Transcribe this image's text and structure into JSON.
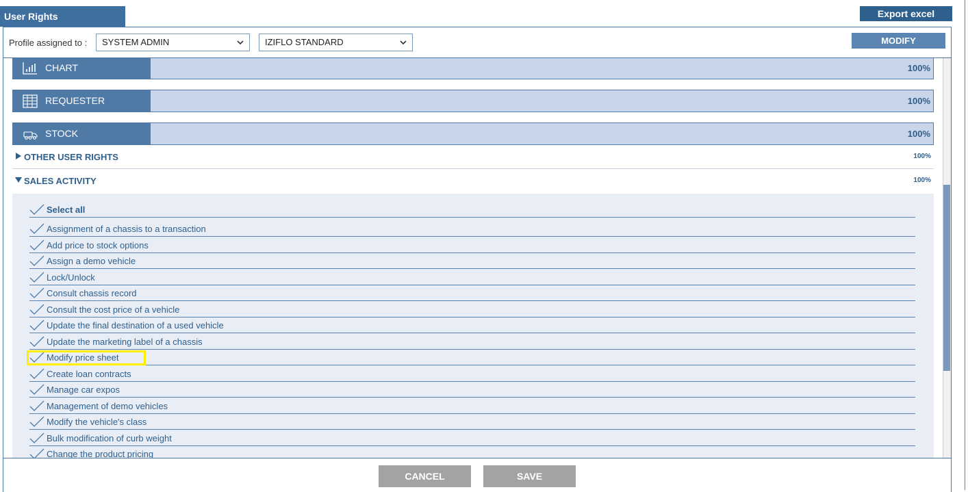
{
  "header": {
    "title": "User Rights",
    "export_label": "Export excel"
  },
  "profile": {
    "label": "Profile assigned to :",
    "select1_value": "SYSTEM ADMIN",
    "select2_value": "IZIFLO STANDARD",
    "modify_label": "MODIFY"
  },
  "sections": [
    {
      "label": "CHART",
      "icon": "bar-chart-icon",
      "percent": "100%"
    },
    {
      "label": "REQUESTER",
      "icon": "table-icon",
      "percent": "100%"
    },
    {
      "label": "STOCK",
      "icon": "truck-icon",
      "percent": "100%"
    }
  ],
  "subsections": [
    {
      "label": "OTHER USER RIGHTS",
      "state": "collapsed",
      "percent": "100%"
    },
    {
      "label": "SALES ACTIVITY",
      "state": "expanded",
      "percent": "100%"
    }
  ],
  "rights": {
    "select_all": "Select all",
    "items": [
      "Assignment of a chassis to a transaction",
      "Add price to stock options",
      "Assign a demo vehicle",
      "Lock/Unlock",
      "Consult chassis record",
      "Consult the cost price of a vehicle",
      "Update the final destination of a used vehicle",
      "Update the marketing label of a chassis",
      "Modify price sheet",
      "Create loan contracts",
      "Manage car expos",
      "Management of demo vehicles",
      "Modify the vehicle's class",
      "Bulk modification of curb weight",
      "Change the product pricing"
    ]
  },
  "footer": {
    "cancel_label": "CANCEL",
    "save_label": "SAVE"
  },
  "colors": {
    "primary": "#4f7aa6",
    "header": "#3e6f9e",
    "section_bg": "#c9d6e9",
    "list_bg": "#e9eef6",
    "highlight": "#ffee00",
    "button_gray": "#a3a3a3"
  }
}
